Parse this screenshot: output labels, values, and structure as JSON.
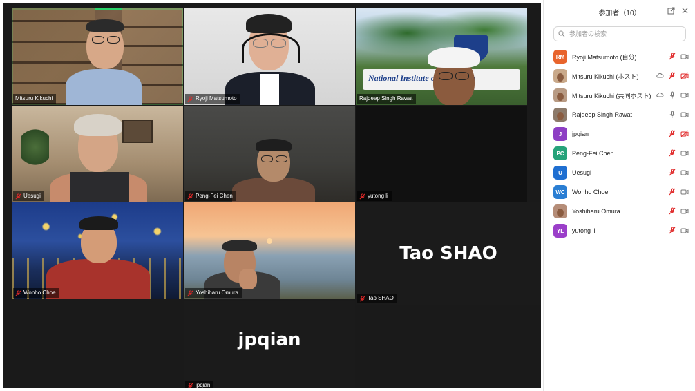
{
  "gallery": {
    "tiles": [
      {
        "name": "Mitsuru Kikuchi",
        "muted": false
      },
      {
        "name": "Ryoji Matsumoto",
        "muted": true
      },
      {
        "name": "Rajdeep Singh Rawat",
        "muted": false
      },
      {
        "name": "Uesugi",
        "muted": true
      },
      {
        "name": "Peng-Fei Chen",
        "muted": true
      },
      {
        "name": "yutong li",
        "muted": true
      },
      {
        "name": "Wonho Choe",
        "muted": true
      },
      {
        "name": "Yoshiharu Omura",
        "muted": true
      },
      {
        "name": "Tao SHAO",
        "muted": true,
        "big_label": "Tao SHAO"
      },
      {
        "name": "jpqian",
        "muted": true,
        "big_label": "jpqian"
      }
    ],
    "background_sign_text": "National Institute of Education"
  },
  "panel": {
    "title": "参加者（10）",
    "search_placeholder": "参加者の検索",
    "participants": [
      {
        "name": "Ryoji Matsumoto (自分)",
        "avatar": "RM",
        "avatar_color": "#e8642c",
        "mic": "muted",
        "video": "on"
      },
      {
        "name": "Mitsuru Kikuchi (ホスト)",
        "avatar": "",
        "avatar_color": "#c9a98a",
        "mic": "muted",
        "video": "off",
        "cloud": true
      },
      {
        "name": "Mitsuru Kikuchi (共同ホスト)",
        "avatar": "",
        "avatar_color": "#b89b84",
        "mic": "on",
        "video": "on",
        "cloud": true
      },
      {
        "name": "Rajdeep Singh Rawat",
        "avatar": "",
        "avatar_color": "#8c7a6a",
        "mic": "on",
        "video": "on"
      },
      {
        "name": "jpqian",
        "avatar": "J",
        "avatar_color": "#8d3fc4",
        "mic": "muted",
        "video": "off"
      },
      {
        "name": "Peng-Fei Chen",
        "avatar": "PC",
        "avatar_color": "#26a37a",
        "mic": "muted",
        "video": "on"
      },
      {
        "name": "Uesugi",
        "avatar": "U",
        "avatar_color": "#1f6fd1",
        "mic": "muted",
        "video": "on"
      },
      {
        "name": "Wonho Choe",
        "avatar": "WC",
        "avatar_color": "#2a7ed3",
        "mic": "muted",
        "video": "on"
      },
      {
        "name": "Yoshiharu Omura",
        "avatar": "",
        "avatar_color": "#b58d78",
        "mic": "muted",
        "video": "on"
      },
      {
        "name": "yutong li",
        "avatar": "YL",
        "avatar_color": "#9b3fc9",
        "mic": "muted",
        "video": "on"
      }
    ]
  },
  "colors": {
    "mute_red": "#e02828",
    "active_speaker": "#2bd36b",
    "icon_gray": "#777777"
  }
}
